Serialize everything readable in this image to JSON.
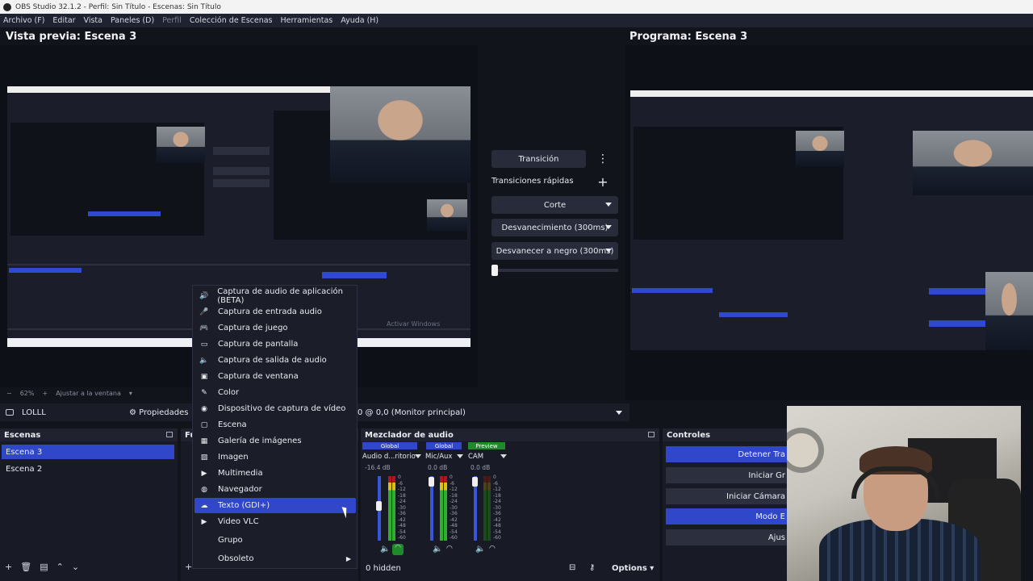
{
  "window": {
    "title": "OBS Studio 32.1.2 - Perfil: Sin Título - Escenas: Sin Título"
  },
  "menu": [
    {
      "label": "Archivo (F)"
    },
    {
      "label": "Editar"
    },
    {
      "label": "Vista"
    },
    {
      "label": "Paneles (D)"
    },
    {
      "label": "Perfil",
      "dim": true
    },
    {
      "label": "Colección de Escenas"
    },
    {
      "label": "Herramientas"
    },
    {
      "label": "Ayuda (H)"
    }
  ],
  "preview": {
    "title": "Vista previa: Escena 3",
    "zoom": "62%",
    "fit_label": "Ajustar a la ventana"
  },
  "program": {
    "title": "Programa: Escena 3"
  },
  "transitions": {
    "transition_button": "Transición",
    "quick_label": "Transiciones rápidas",
    "options": [
      "Corte",
      "Desvanecimiento (300ms)",
      "Desvanecer a negro (300ms)"
    ]
  },
  "source_toolbar": {
    "source_name": "LOLLL",
    "properties": "Propiedades",
    "monitor": "0 @ 0,0 (Monitor principal)"
  },
  "scenes": {
    "title": "Escenas",
    "items": [
      "Escena 3",
      "Escena 2"
    ],
    "active": "Escena 3"
  },
  "sources_head": "Fu",
  "context_menu": {
    "items": [
      {
        "icon": "app-audio-icon",
        "glyph": "🔊",
        "label": "Captura de audio de aplicación (BETA)"
      },
      {
        "icon": "mic-icon",
        "glyph": "🎤",
        "label": "Captura de entrada audio"
      },
      {
        "icon": "gamepad-icon",
        "glyph": "🎮",
        "label": "Captura de juego"
      },
      {
        "icon": "monitor-icon",
        "glyph": "▭",
        "label": "Captura de pantalla"
      },
      {
        "icon": "speaker-icon",
        "glyph": "🔈",
        "label": "Captura de salida de audio"
      },
      {
        "icon": "window-icon",
        "glyph": "▣",
        "label": "Captura de ventana"
      },
      {
        "icon": "brush-icon",
        "glyph": "✎",
        "label": "Color"
      },
      {
        "icon": "camera-icon",
        "glyph": "◉",
        "label": "Dispositivo de captura de vídeo"
      },
      {
        "icon": "scene-icon",
        "glyph": "▢",
        "label": "Escena"
      },
      {
        "icon": "gallery-icon",
        "glyph": "▦",
        "label": "Galería de imágenes"
      },
      {
        "icon": "image-icon",
        "glyph": "▨",
        "label": "Imagen"
      },
      {
        "icon": "play-icon",
        "glyph": "▶",
        "label": "Multimedia"
      },
      {
        "icon": "globe-icon",
        "glyph": "◍",
        "label": "Navegador"
      },
      {
        "icon": "text-icon",
        "glyph": "☁",
        "label": "Texto (GDI+)"
      },
      {
        "icon": "play-icon",
        "glyph": "▶",
        "label": "Video VLC"
      },
      {
        "icon": "group-icon",
        "glyph": "",
        "label": "Grupo"
      },
      {
        "icon": "deprecated-icon",
        "glyph": "",
        "label": "Obsoleto"
      }
    ],
    "highlighted_index": 13
  },
  "mixer": {
    "title": "Mezclador de audio",
    "channels": [
      {
        "badge": "Global",
        "badge_color": "#3047c9",
        "name": "Audio d...ritorio",
        "db": "-16.4 dB"
      },
      {
        "badge": "Global",
        "badge_color": "#3047c9",
        "name": "Mic/Aux",
        "db": "0.0 dB"
      },
      {
        "badge": "Preview",
        "badge_color": "#1f8a2a",
        "name": "CAM",
        "db": "0.0 dB"
      }
    ],
    "ticks": [
      "0",
      "-6",
      "-12",
      "-18",
      "-24",
      "-30",
      "-36",
      "-42",
      "-48",
      "-54",
      "-60"
    ],
    "hidden_label": "0 hidden",
    "options_label": "Options"
  },
  "controls": {
    "title": "Controles",
    "buttons": [
      {
        "label": "Detener Tra",
        "blue": true
      },
      {
        "label": "Iniciar Gr",
        "blue": false
      },
      {
        "label": "Iniciar Cámara",
        "blue": false
      },
      {
        "label": "Modo E",
        "blue": true
      },
      {
        "label": "Ajus",
        "blue": false
      }
    ]
  },
  "colors": {
    "accent": "#3047c9",
    "background": "#12141c",
    "panel": "#181b26"
  }
}
